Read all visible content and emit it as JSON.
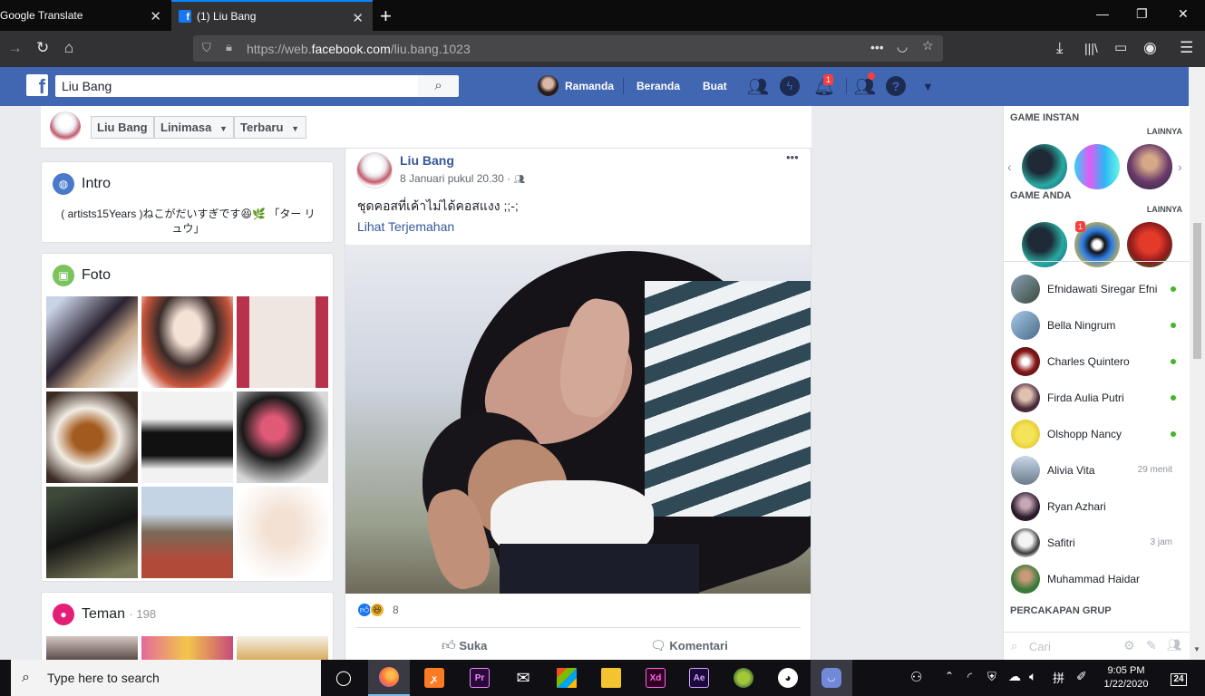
{
  "browser": {
    "tabs": [
      {
        "title": "Google Translate"
      },
      {
        "title": "(1) Liu Bang"
      }
    ],
    "url_prefix": "https://web.",
    "url_domain": "facebook.com",
    "url_path": "/liu.bang.1023",
    "url_dots": "•••"
  },
  "fb_header": {
    "search_value": "Liu Bang",
    "user_name": "Ramanda",
    "home_label": "Beranda",
    "create_label": "Buat",
    "notif_count": "1"
  },
  "profile_nav": {
    "name": "Liu Bang",
    "timeline": "Linimasa",
    "latest": "Terbaru"
  },
  "intro": {
    "title": "Intro",
    "bio": "( artists15Years )ねこがだいすぎです😆🌿 「ター リュウ」"
  },
  "photos": {
    "title": "Foto"
  },
  "friends": {
    "title": "Teman",
    "count": "· 198"
  },
  "post": {
    "author": "Liu Bang",
    "time": "8 Januari pukul 20.30 ·",
    "text": "ชุดคอสที่เค้าไม่ได้คอสแงง ;;-;",
    "translate": "Lihat Terjemahan",
    "reactions_count": "8",
    "like_label": "Suka",
    "comment_label": "Komentari",
    "more": "•••"
  },
  "sidebar": {
    "instant_games": "GAME INSTAN",
    "your_games": "GAME ANDA",
    "more": "LAINNYA",
    "group_chats": "PERCAKAPAN GRUP",
    "search_placeholder": "Cari",
    "contacts": [
      {
        "name": "Efnidawati Siregar Efni",
        "status": "online",
        "time": ""
      },
      {
        "name": "Bella Ningrum",
        "status": "online",
        "time": ""
      },
      {
        "name": "Charles Quintero",
        "status": "online",
        "time": ""
      },
      {
        "name": "Firda Aulia Putri",
        "status": "online",
        "time": ""
      },
      {
        "name": "Olshopp Nancy",
        "status": "online",
        "time": ""
      },
      {
        "name": "Alivia Vita",
        "status": "away",
        "time": "29 menit"
      },
      {
        "name": "Ryan Azhari",
        "status": "offline",
        "time": ""
      },
      {
        "name": "Safitri",
        "status": "away",
        "time": "3 jam"
      },
      {
        "name": "Muhammad Haidar",
        "status": "offline",
        "time": ""
      }
    ]
  },
  "taskbar": {
    "search_placeholder": "Type here to search",
    "time": "9:05 PM",
    "date": "1/22/2020",
    "notif_count": "24",
    "apps": [
      {
        "name": "Firefox"
      },
      {
        "name": "XAMPP"
      },
      {
        "name": "Premiere Pro",
        "label": "Pr"
      },
      {
        "name": "Mail"
      },
      {
        "name": "Store"
      },
      {
        "name": "File Explorer"
      },
      {
        "name": "Adobe XD",
        "label": "Xd"
      },
      {
        "name": "After Effects",
        "label": "Ae"
      },
      {
        "name": "Android Studio"
      },
      {
        "name": "Game"
      },
      {
        "name": "Discord"
      }
    ]
  }
}
